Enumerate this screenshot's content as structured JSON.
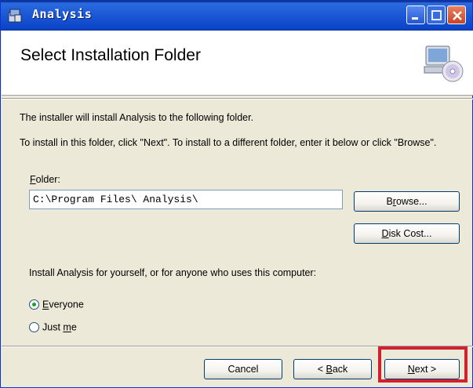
{
  "window": {
    "title": "Analysis",
    "accent_color": "#0a46c9"
  },
  "banner": {
    "heading": "Select Installation Folder",
    "icon": "computer-disc-icon"
  },
  "body": {
    "line1": "The installer will install Analysis to the following folder.",
    "line2": "To install in this folder, click \"Next\". To install to a different folder, enter it below or click \"Browse\"."
  },
  "folder": {
    "label_prefix": "",
    "label_accel": "F",
    "label_rest": "older:",
    "value": "C:\\Program Files\\ Analysis\\"
  },
  "buttons": {
    "browse_accel": "r",
    "browse_pre": "B",
    "browse_post": "owse...",
    "diskcost_accel": "D",
    "diskcost_post": "isk Cost...",
    "cancel": "Cancel",
    "back_pre": "< ",
    "back_accel": "B",
    "back_post": "ack",
    "next_accel": "N",
    "next_post": "ext >"
  },
  "install_for": {
    "text": "Install  Analysis for yourself, or for anyone who uses this computer:",
    "options": [
      {
        "accel": "E",
        "rest": "veryone",
        "pre": "",
        "checked": true
      },
      {
        "accel": "m",
        "rest": "e",
        "pre": "Just ",
        "checked": false
      }
    ]
  },
  "highlight_color": "#d2202e"
}
